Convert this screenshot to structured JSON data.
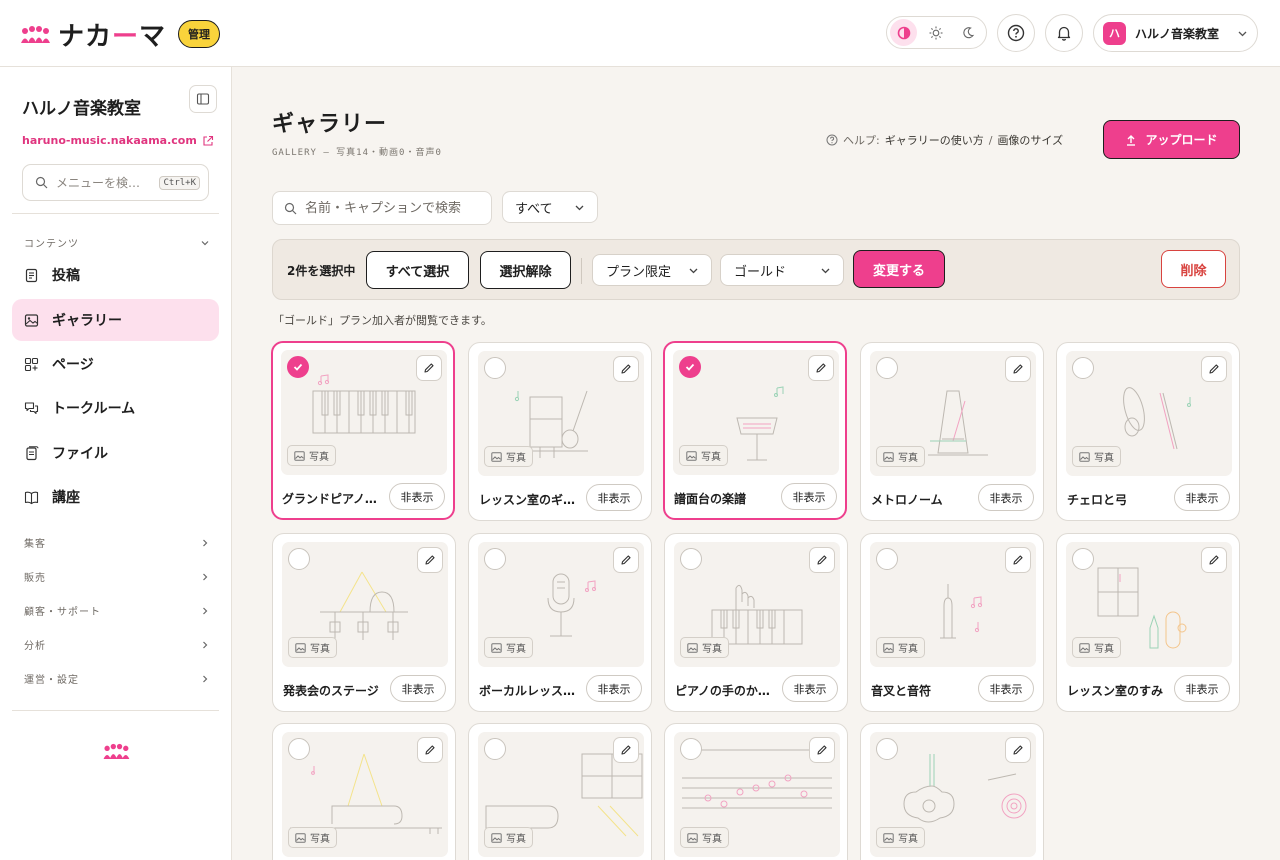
{
  "app": {
    "logo_text_a": "ナカ",
    "logo_text_b": "ー",
    "logo_text_c": "マ",
    "admin_badge": "管理",
    "account_initial": "ハ",
    "account_name": "ハルノ音楽教室",
    "accent_color": "#ee3f8d"
  },
  "sidebar": {
    "site_title": "ハルノ音楽教室",
    "site_url": "haruno-music.nakaama.com",
    "search_placeholder": "メニューを検…",
    "search_shortcut": "Ctrl+K",
    "content_section": "コンテンツ",
    "items": [
      {
        "label": "投稿",
        "icon": "document-icon"
      },
      {
        "label": "ギャラリー",
        "icon": "image-icon",
        "active": true
      },
      {
        "label": "ページ",
        "icon": "pages-icon"
      },
      {
        "label": "トークルーム",
        "icon": "chat-icon"
      },
      {
        "label": "ファイル",
        "icon": "files-icon"
      },
      {
        "label": "講座",
        "icon": "book-icon"
      }
    ],
    "sections": [
      "集客",
      "販売",
      "顧客・サポート",
      "分析",
      "運営・設定"
    ]
  },
  "page": {
    "title": "ギャラリー",
    "subtitle": "GALLERY — 写真14・動画0・音声0",
    "help_label": "ヘルプ:",
    "help_link1": "ギャラリーの使い方",
    "help_sep": "/",
    "help_link2": "画像のサイズ",
    "upload_label": "アップロード",
    "search_placeholder": "名前・キャプションで検索",
    "filter_value": "すべて"
  },
  "bulk": {
    "count_label": "2件を選択中",
    "select_all": "すべて選択",
    "deselect": "選択解除",
    "plan_select": "プラン限定",
    "tier_select": "ゴールド",
    "apply": "変更する",
    "delete": "削除",
    "note": "「ゴールド」プラン加入者が閲覧できます。"
  },
  "gallery": {
    "type_label": "写真",
    "hide_label": "非表示",
    "items": [
      {
        "name": "グランドピアノ…",
        "selected": true
      },
      {
        "name": "レッスン室のギ…",
        "selected": false
      },
      {
        "name": "譜面台の楽譜",
        "selected": true
      },
      {
        "name": "メトロノーム",
        "selected": false
      },
      {
        "name": "チェロと弓",
        "selected": false
      },
      {
        "name": "発表会のステージ",
        "selected": false
      },
      {
        "name": "ボーカルレッス…",
        "selected": false
      },
      {
        "name": "ピアノの手のか…",
        "selected": false
      },
      {
        "name": "音叉と音符",
        "selected": false
      },
      {
        "name": "レッスン室のすみ",
        "selected": false
      },
      {
        "name": "",
        "selected": false
      },
      {
        "name": "",
        "selected": false
      },
      {
        "name": "",
        "selected": false
      },
      {
        "name": "",
        "selected": false
      }
    ]
  }
}
